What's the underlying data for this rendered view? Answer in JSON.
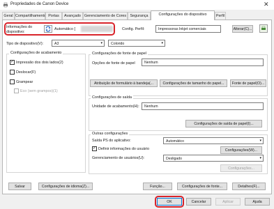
{
  "window": {
    "title": "Propriedades de Canon Device",
    "close_glyph": "✕"
  },
  "tabs": [
    "Geral",
    "Compartilhamento",
    "Portas",
    "Avançado",
    "Gerenciamento de Cores",
    "Segurança",
    "Configurações do dispositivo",
    "Perfil"
  ],
  "active_tab": "Configurações do dispositivo",
  "device_info": {
    "label_line1": "Informações do",
    "label_line2": "dispositivo:",
    "value": "Automático ["
  },
  "profile": {
    "label": "Config. Perfil:",
    "value": "Impressoras Inkjet comerciais",
    "change_button": "Alterar(C)..."
  },
  "device_type": {
    "label": "Tipo de dispositivo(V):",
    "size_value": "A3",
    "color_value": "Colorido"
  },
  "finishing": {
    "title": "Configurações de acabamento",
    "options": [
      {
        "label": "Impressão dos dois lados(2)",
        "checked": true,
        "enabled": true
      },
      {
        "label": "Deslocar(F)",
        "checked": false,
        "enabled": true
      },
      {
        "label": "Grampear",
        "checked": false,
        "enabled": true
      },
      {
        "label": "Eco (sem grampos)(1)",
        "checked": false,
        "enabled": false
      }
    ]
  },
  "paper_source": {
    "title": "Configurações de fonte de papel",
    "option_label": "Opções de fonte de papel",
    "option_value": "Nenhum",
    "buttons": [
      "Atribuição de formulário à bandeja(...",
      "Configurações de tamanho do papel...",
      "Fonte de papel(O)..."
    ]
  },
  "output": {
    "title": "Configurações de saída",
    "unit_label": "Unidade de acabamento(H):",
    "unit_value": "Nenhum",
    "button": "Configurações de saída de papel(I)..."
  },
  "other": {
    "title": "Outras configurações",
    "ps_label": "Saída PS do aplicativo:",
    "ps_value": "Automático",
    "user_info_label": "Definir informações do usuário",
    "user_info_checked": true,
    "user_info_button": "Configurações(W)...",
    "user_mgmt_label": "Gerenciamento de usuários(U):",
    "user_mgmt_value": "Desligado",
    "user_mgmt_button": "Configurações..."
  },
  "bottom_buttons": {
    "save": "Salvar",
    "language": "Configurações de idioma(Z)...",
    "function": "Função...",
    "source": "Configurações de fonte...",
    "details": "Detalhes(F)..."
  },
  "dialog_buttons": {
    "ok": "OK",
    "cancel": "Cancelar",
    "apply": "Aplicar",
    "help": "Ajuda"
  },
  "colors": {
    "highlight_ring": "#d8232a",
    "ok_button_border": "#0078d7"
  }
}
